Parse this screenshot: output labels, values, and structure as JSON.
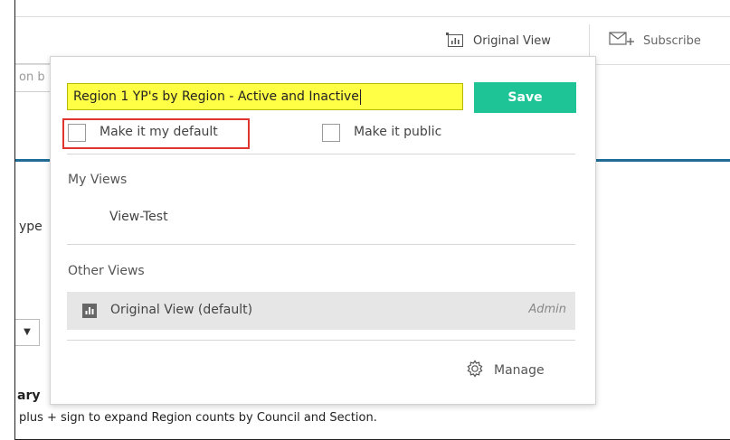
{
  "toolbar": {
    "original_view_label": "Original View",
    "subscribe_label": "Subscribe"
  },
  "background": {
    "search_fragment": "on b",
    "type_fragment": "ype",
    "dropdown_caret": "▼",
    "summary_fragment": "ary",
    "help_text": "plus + sign to expand Region counts by Council and Section."
  },
  "popup": {
    "name_value": "Region 1 YP's by Region - Active and Inactive",
    "save_label": "Save",
    "make_default_label": "Make it my default",
    "make_default_checked": false,
    "make_public_label": "Make it public",
    "make_public_checked": false,
    "my_views_title": "My Views",
    "my_views": [
      {
        "name": "View-Test"
      }
    ],
    "other_views_title": "Other Views",
    "other_views": [
      {
        "name": "Original View (default)",
        "owner": "Admin"
      }
    ],
    "manage_label": "Manage"
  },
  "colors": {
    "save_button": "#1ec396",
    "name_field": "#ffff45",
    "highlight_box": "#e0342e",
    "accent_line": "#1f6d97",
    "selected_row": "#e6e6e6"
  },
  "icons": [
    "chart-icon",
    "mail-plus-icon",
    "chart-badge-icon",
    "gear-icon"
  ]
}
